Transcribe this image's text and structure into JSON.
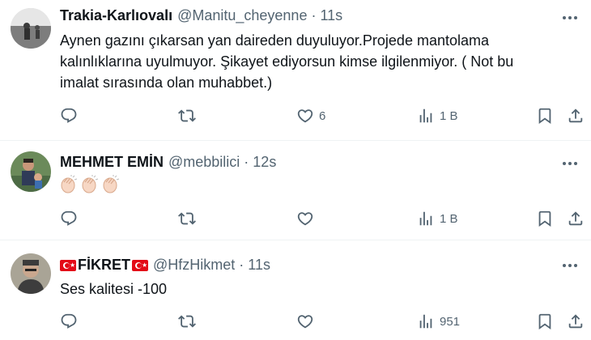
{
  "tweets": [
    {
      "name": "Trakia-Karlıovalı",
      "handle": "@Manitu_cheyenne",
      "separator": "·",
      "time": "11s",
      "lines": [
        "Aynen gazını çıkarsan yan daireden duyuluyor.Projede mantolama",
        "kalınlıklarına uyulmuyor. Şikayet ediyorsun kimse ilgilenmiyor. ( Not bu",
        "imalat sırasında olan muhabbet.)"
      ],
      "likes": "6",
      "views": "1 B"
    },
    {
      "name": "MEHMET EMİN",
      "handle": "@mebbilici",
      "separator": "·",
      "time": "12s",
      "emoji": [
        "clapping-hands",
        "clapping-hands",
        "clapping-hands"
      ],
      "views": "1 B"
    },
    {
      "name": "FİKRET",
      "handle": "@HfzHikmet",
      "separator": "·",
      "time": "11s",
      "text": "Ses kalitesi -100",
      "views": "951"
    }
  ],
  "colors": {
    "text": "#0f1419",
    "secondary": "#536471",
    "divider": "#eff3f4",
    "flag_red": "#e30a17"
  },
  "icons": [
    "reply-icon",
    "retweet-icon",
    "like-icon",
    "views-icon",
    "bookmark-icon",
    "share-icon",
    "more-icon"
  ]
}
